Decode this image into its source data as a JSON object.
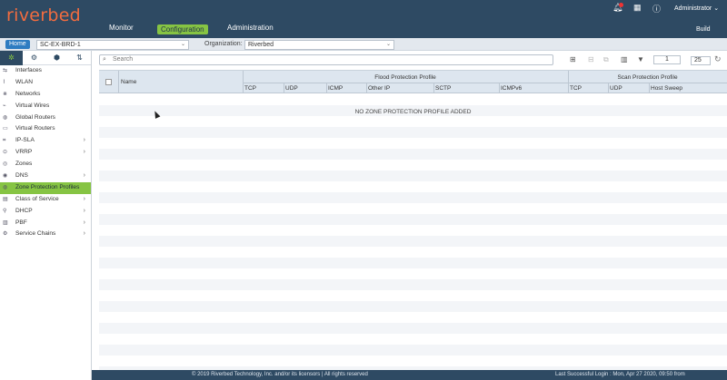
{
  "header": {
    "logo": "riverbed",
    "nav": {
      "monitor": "Monitor",
      "configuration": "Configuration",
      "administration": "Administration"
    },
    "user": "Administrator",
    "build": "Build",
    "icons": {
      "bell": "bell-icon",
      "grid": "grid-icon",
      "info": "info-icon"
    }
  },
  "crumb": {
    "home": "Home",
    "appliance": "SC-EX-BRD-1",
    "org_label": "Organization:",
    "org_value": "Riverbed"
  },
  "sidebar": {
    "items": [
      {
        "label": "Interfaces",
        "chevron": false,
        "active": false
      },
      {
        "label": "WLAN",
        "chevron": false,
        "active": false
      },
      {
        "label": "Networks",
        "chevron": false,
        "active": false
      },
      {
        "label": "Virtual Wires",
        "chevron": false,
        "active": false
      },
      {
        "label": "Global Routers",
        "chevron": false,
        "active": false
      },
      {
        "label": "Virtual Routers",
        "chevron": false,
        "active": false
      },
      {
        "label": "IP-SLA",
        "chevron": true,
        "active": false
      },
      {
        "label": "VRRP",
        "chevron": true,
        "active": false
      },
      {
        "label": "Zones",
        "chevron": false,
        "active": false
      },
      {
        "label": "DNS",
        "chevron": true,
        "active": false
      },
      {
        "label": "Zone Protection Profiles",
        "chevron": false,
        "active": true
      },
      {
        "label": "Class of Service",
        "chevron": true,
        "active": false
      },
      {
        "label": "DHCP",
        "chevron": true,
        "active": false
      },
      {
        "label": "PBF",
        "chevron": true,
        "active": false
      },
      {
        "label": "Service Chains",
        "chevron": true,
        "active": false
      }
    ]
  },
  "main": {
    "search_placeholder": "Search",
    "pager_value": "1",
    "per_page": "25",
    "table": {
      "name_header": "Name",
      "flood_group": "Flood Protection Profile",
      "scan_group": "Scan Protection Profile",
      "flood_cols": [
        "TCP",
        "UDP",
        "ICMP",
        "Other IP",
        "SCTP",
        "ICMPv6"
      ],
      "scan_cols": [
        "TCP",
        "UDP",
        "Host Sweep"
      ],
      "empty_message": "NO ZONE PROTECTION PROFILE ADDED"
    }
  },
  "footer": {
    "copyright": "© 2019 Riverbed Technology, Inc. and/or its licensors | All rights reserved",
    "last_login": "Last Successful Login : Mon, Apr 27 2020, 09:50 from 139.167.220.196"
  },
  "colors": {
    "header": "#2e4a63",
    "accent": "#86c443",
    "logo": "#f26c3f"
  }
}
